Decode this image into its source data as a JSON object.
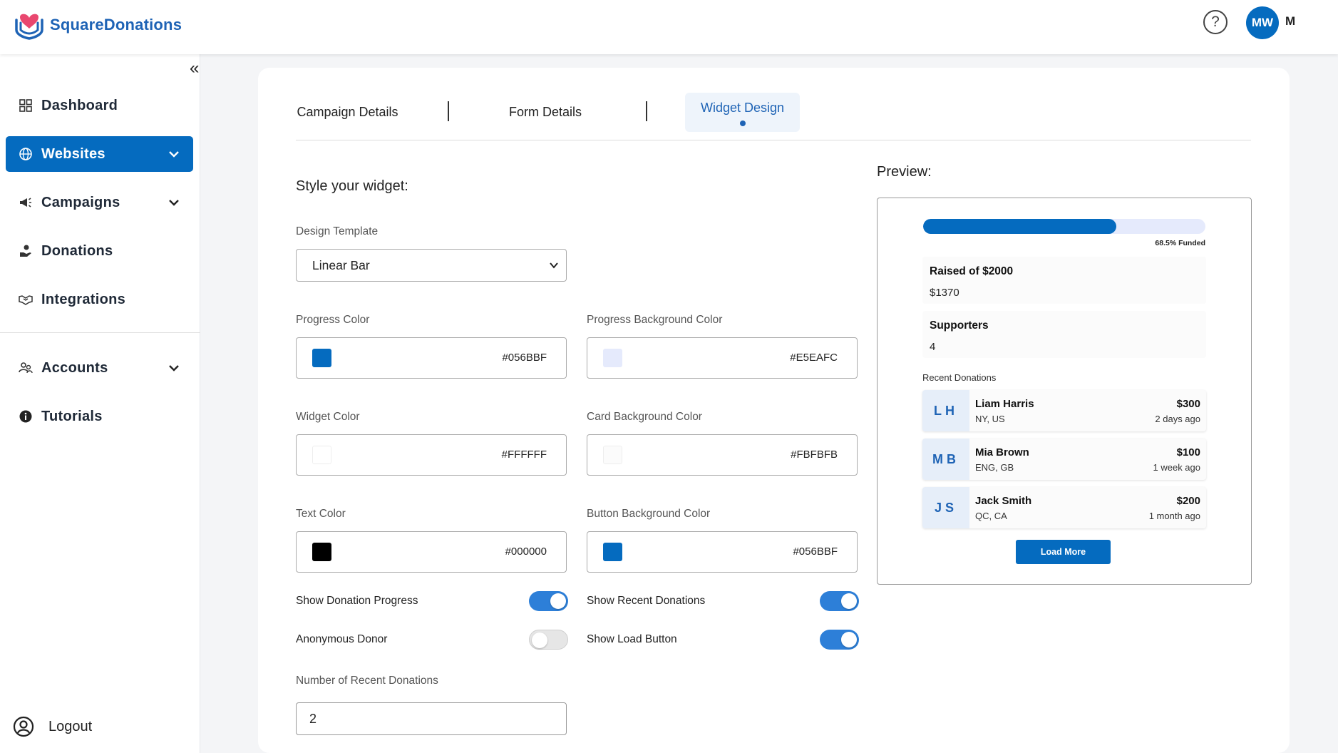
{
  "app": {
    "name": "SquareDonations"
  },
  "header": {
    "user_initials": "MW",
    "user_name": "M"
  },
  "sidebar": {
    "items": [
      {
        "label": "Dashboard"
      },
      {
        "label": "Websites"
      },
      {
        "label": "Campaigns"
      },
      {
        "label": "Donations"
      },
      {
        "label": "Integrations"
      },
      {
        "label": "Accounts"
      },
      {
        "label": "Tutorials"
      }
    ],
    "logout_label": "Logout"
  },
  "tabs": [
    {
      "label": "Campaign Details"
    },
    {
      "label": "Form Details"
    },
    {
      "label": "Widget Design"
    }
  ],
  "form": {
    "title": "Style your widget:",
    "design_template": {
      "label": "Design Template",
      "value": "Linear Bar"
    },
    "progress_color": {
      "label": "Progress Color",
      "value": "#056BBF"
    },
    "progress_bg_color": {
      "label": "Progress Background Color",
      "value": "#E5EAFC"
    },
    "widget_color": {
      "label": "Widget Color",
      "value": "#FFFFFF"
    },
    "card_bg_color": {
      "label": "Card Background Color",
      "value": "#FBFBFB"
    },
    "text_color": {
      "label": "Text Color",
      "value": "#000000"
    },
    "button_bg_color": {
      "label": "Button Background Color",
      "value": "#056BBF"
    },
    "toggles": {
      "show_donation_progress": {
        "label": "Show Donation Progress",
        "on": true
      },
      "show_recent_donations": {
        "label": "Show Recent Donations",
        "on": true
      },
      "anonymous_donor": {
        "label": "Anonymous Donor",
        "on": false
      },
      "show_load_button": {
        "label": "Show Load Button",
        "on": true
      }
    },
    "num_recent_donations": {
      "label": "Number of Recent Donations",
      "value": "2"
    }
  },
  "preview": {
    "label": "Preview:",
    "progress_fraction": 0.685,
    "funded_text": "68.5% Funded",
    "raised": {
      "title": "Raised of $2000",
      "value": "$1370"
    },
    "supporters": {
      "title": "Supporters",
      "value": "4"
    },
    "recent_label": "Recent Donations",
    "donations": [
      {
        "initials": "LH",
        "name": "Liam Harris",
        "location": "NY, US",
        "amount": "$300",
        "time": "2 days ago"
      },
      {
        "initials": "MB",
        "name": "Mia Brown",
        "location": "ENG, GB",
        "amount": "$100",
        "time": "1 week ago"
      },
      {
        "initials": "JS",
        "name": "Jack Smith",
        "location": "QC, CA",
        "amount": "$200",
        "time": "1 month ago"
      }
    ],
    "load_more_label": "Load More"
  },
  "colors": {
    "accent": "#056BBF",
    "brand_text": "#1E63B5",
    "toggle_on": "#2D7FD8"
  },
  "icons": {
    "help": "question-circle-icon",
    "collapse": "double-chevron-left-icon",
    "logout": "user-circle-icon"
  }
}
